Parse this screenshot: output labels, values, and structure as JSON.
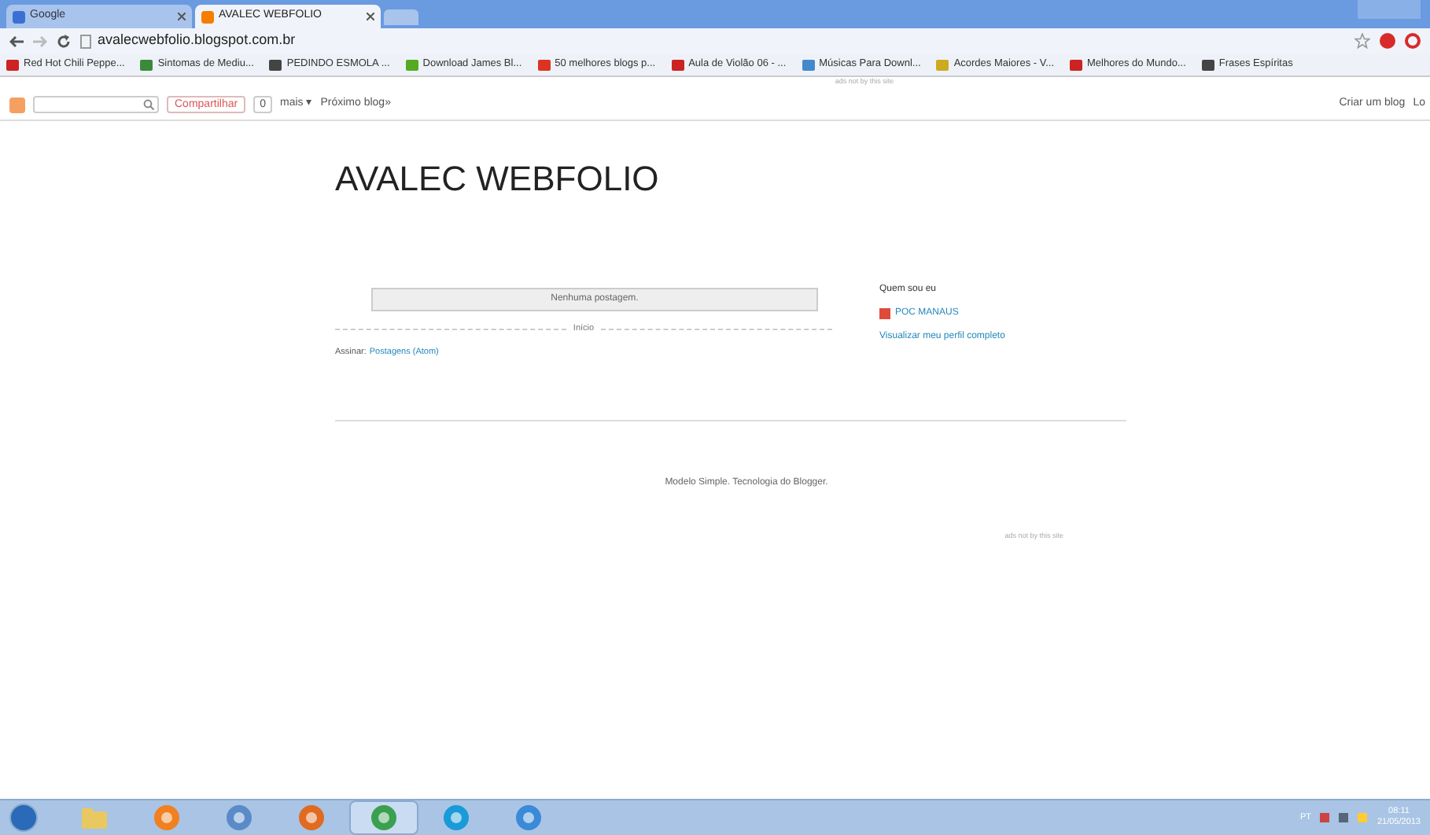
{
  "tabs": [
    {
      "label": "Google",
      "selected": false
    },
    {
      "label": "AVALEC WEBFOLIO",
      "selected": true
    }
  ],
  "address": "avalecwebfolio.blogspot.com.br",
  "bookmarks": [
    {
      "label": "Red Hot Chili Peppe...",
      "color": "#cc2222"
    },
    {
      "label": "Sintomas de Mediu...",
      "color": "#3a8a3a"
    },
    {
      "label": "PEDINDO ESMOLA ...",
      "color": "#444444"
    },
    {
      "label": "Download James Bl...",
      "color": "#55aa22"
    },
    {
      "label": "50 melhores blogs p...",
      "color": "#dd3322"
    },
    {
      "label": "Aula de Violão 06 - ...",
      "color": "#cc2222"
    },
    {
      "label": "Músicas Para Downl...",
      "color": "#4488cc"
    },
    {
      "label": "Acordes Maiores - V...",
      "color": "#ccaa22"
    },
    {
      "label": "Melhores do Mundo...",
      "color": "#cc2222"
    },
    {
      "label": "Frases Espíritas",
      "color": "#444444"
    }
  ],
  "ad_notice_top": "ads not by this site",
  "navbar": {
    "share": "Compartilhar",
    "count": "0",
    "more": "mais ▾",
    "next": "Próximo blog»",
    "create": "Criar um blog",
    "login": "Lo"
  },
  "blog": {
    "title": "AVALEC WEBFOLIO",
    "no_posts": "Nenhuma postagem.",
    "home": "Início",
    "subscribe_label": "Assinar:",
    "subscribe_link": "Postagens (Atom)",
    "about_heading": "Quem sou eu",
    "profile_name": "POC MANAUS",
    "profile_link": "Visualizar meu perfil completo",
    "footer": "Modelo Simple. Tecnologia do Blogger.",
    "ad_notice_bottom": "ads not by this site"
  },
  "taskbar": {
    "apps": [
      {
        "kind": "folder",
        "selected": false
      },
      {
        "kind": "media",
        "selected": false
      },
      {
        "kind": "paint",
        "selected": false
      },
      {
        "kind": "firefox",
        "selected": false
      },
      {
        "kind": "chrome",
        "selected": true
      },
      {
        "kind": "skype",
        "selected": false
      },
      {
        "kind": "ie",
        "selected": false
      }
    ],
    "language": "PT",
    "time": "08:11",
    "date": "21/05/2013"
  }
}
